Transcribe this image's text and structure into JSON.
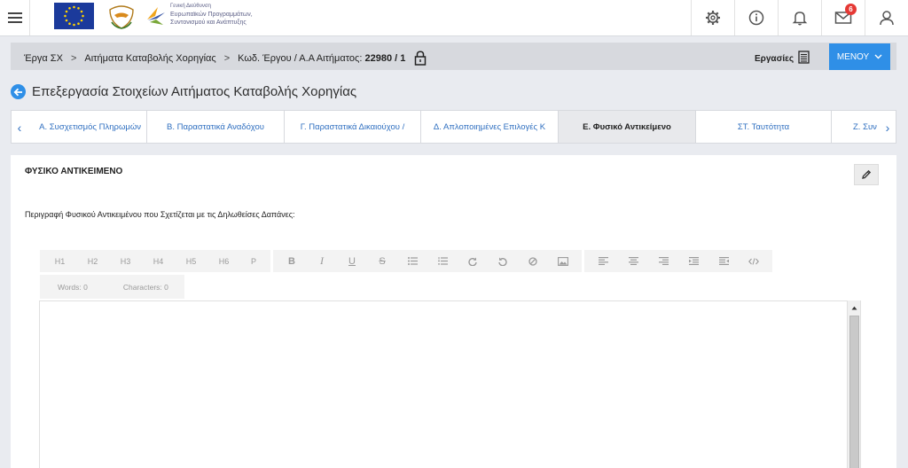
{
  "header": {
    "logo_text": [
      "Γενική Διεύθυνση",
      "Ευρωπαϊκών Προγραμμάτων,",
      "Συντονισμού και Ανάπτυξης"
    ],
    "notification_count": "6",
    "icons": [
      "menu-icon",
      "gear-icon",
      "info-icon",
      "bell-icon",
      "mail-icon",
      "user-icon"
    ]
  },
  "breadcrumb": {
    "item1": "Έργα ΣΧ",
    "item2": "Αιτήματα Καταβολής Χορηγίας",
    "item3_label": "Κωδ. Έργου / Α.Α Αιτήματος:",
    "item3_value": "22980 / 1",
    "tasks_label": "Εργασίες",
    "menu_label": "ΜΕΝΟΥ"
  },
  "page": {
    "title": "Επεξεργασία Στοιχείων Αιτήματος Καταβολής Χορηγίας"
  },
  "tabs": [
    {
      "label": "Α. Συσχετισμός Πληρωμών",
      "active": false
    },
    {
      "label": "Β. Παραστατικά Αναδόχου",
      "active": false
    },
    {
      "label": "Γ. Παραστατικά Δικαιούχου / ",
      "active": false
    },
    {
      "label": "Δ. Απλοποιημένες Επιλογές Κ",
      "active": false
    },
    {
      "label": "Ε. Φυσικό Αντικείμενο",
      "active": true
    },
    {
      "label": "ΣΤ. Ταυτότητα",
      "active": false
    },
    {
      "label": "Ζ. Συν",
      "active": false
    }
  ],
  "panel": {
    "title": "ΦΥΣΙΚΟ ΑΝΤΙΚΕΙΜΕΝΟ",
    "field_label": "Περιγραφή Φυσικού Αντικειμένου που Σχετίζεται με τις Δηλωθείσες Δαπάνες:"
  },
  "editor": {
    "headings": [
      "H1",
      "H2",
      "H3",
      "H4",
      "H5",
      "H6",
      "P"
    ],
    "words": "Words: 0",
    "characters": "Characters: 0",
    "content": ""
  },
  "colors": {
    "accent": "#2f8fe7",
    "link": "#2f6fc0",
    "badge": "#e53935"
  }
}
